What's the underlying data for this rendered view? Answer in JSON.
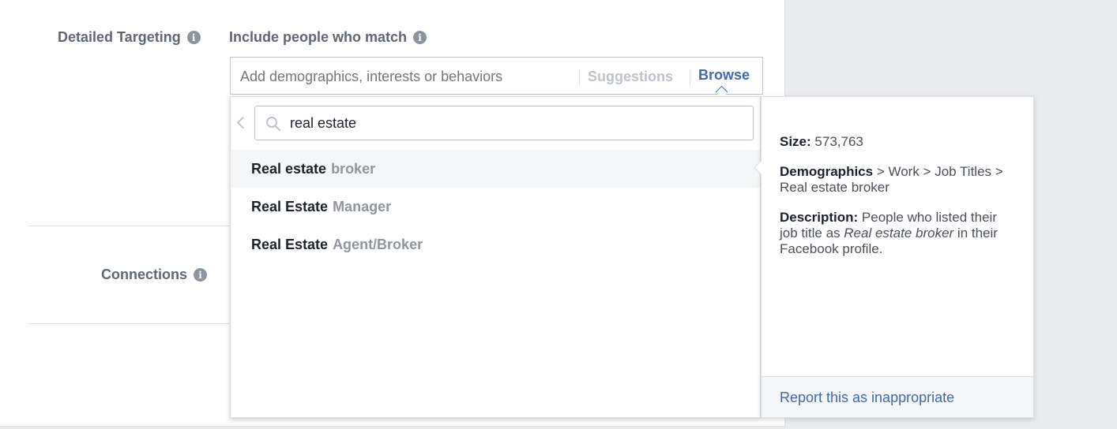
{
  "detailed_targeting": {
    "label": "Detailed Targeting",
    "include_label": "Include people who match",
    "input_placeholder": "Add demographics, interests or behaviors",
    "suggestions_label": "Suggestions",
    "browse_label": "Browse"
  },
  "connections": {
    "label": "Connections"
  },
  "dropdown": {
    "search_value": "real estate",
    "results": [
      {
        "strong": "Real estate",
        "muted": "broker"
      },
      {
        "strong": "Real Estate",
        "muted": "Manager"
      },
      {
        "strong": "Real Estate",
        "muted": "Agent/Broker"
      }
    ]
  },
  "detail": {
    "size_label": "Size:",
    "size_value": "573,763",
    "category_label": "Demographics",
    "category_path": "> Work > Job Titles > Real estate broker",
    "description_label": "Description:",
    "description_before": "People who listed their job title as",
    "description_italic": "Real estate broker",
    "description_after": "in their Facebook profile.",
    "report_link": "Report this as inappropriate"
  },
  "icons": {
    "info": "info-icon",
    "search": "search-icon",
    "back": "chevron-left-icon"
  },
  "colors": {
    "link": "#4267b2",
    "muted": "#90949c",
    "background": "#e9ebee"
  }
}
